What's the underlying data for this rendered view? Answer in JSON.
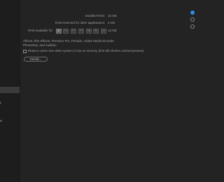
{
  "sidebar": {
    "items": [
      {
        "label": "ache",
        "selected": false
      },
      {
        "label": "e",
        "selected": true
      },
      {
        "label": "e",
        "selected": false
      },
      {
        "label": "apping",
        "selected": false
      },
      {
        "label": "essions",
        "selected": false
      }
    ]
  },
  "memory": {
    "installed_ram_label": "Installed RAM:",
    "installed_ram_value": "16 GB",
    "reserved_label": "RAM reserved for other applications:",
    "reserved_value": "3 GB",
    "available_label": "RAM available for:",
    "available_value": "13 GB",
    "app_icons": [
      "Ae",
      "Ps",
      "Pr",
      "Pl",
      "Me",
      "Br",
      "Ch"
    ],
    "affects_text": "Affects After Effects, Premiere Pro, Prelude, Adobe Media Encoder, Photoshop, and Audition",
    "reduce_cache_label": "Reduce cache size when system is low on memory (this will shorten cached preview)",
    "details_button": "Details..."
  },
  "colors": {
    "accent": "#2d8ceb",
    "background": "#232323",
    "sidebar_bg": "#1d1d1d"
  }
}
